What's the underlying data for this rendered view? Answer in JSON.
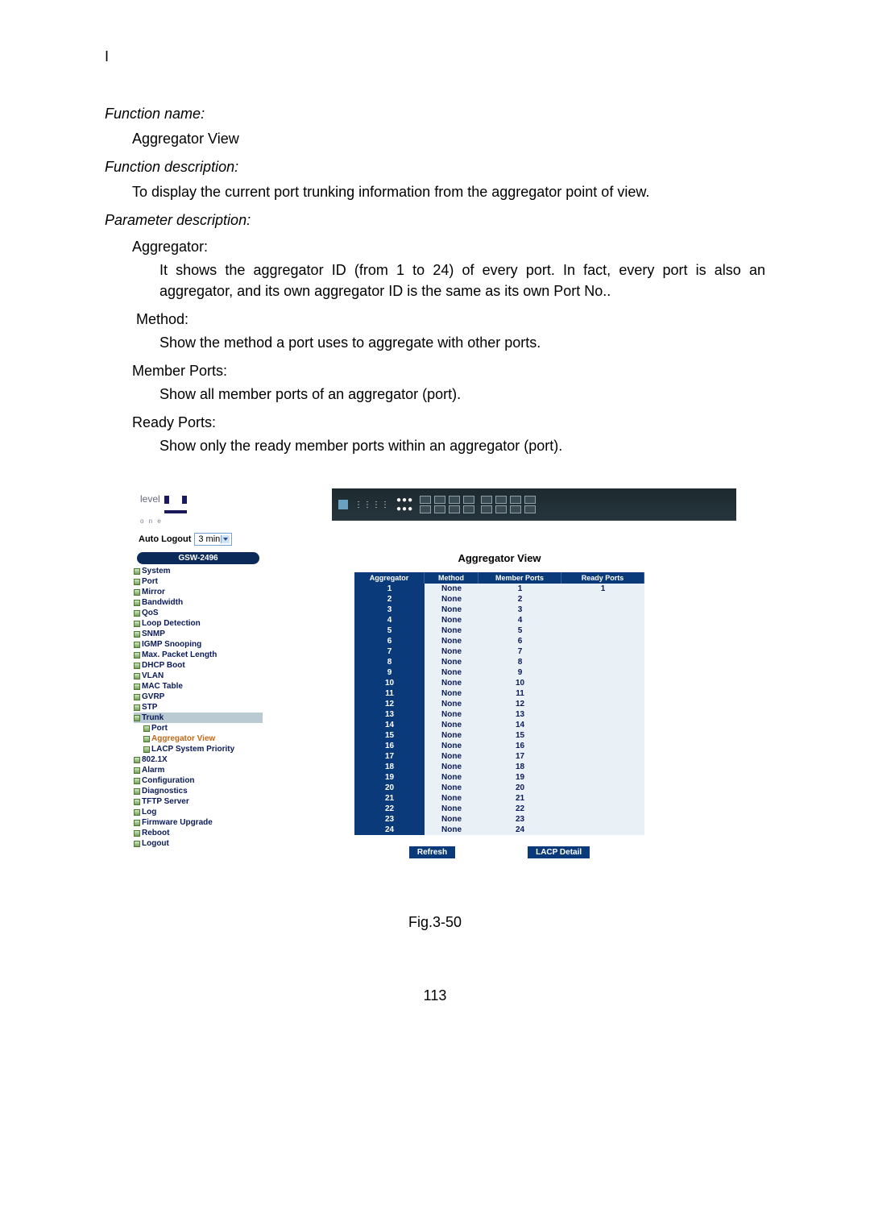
{
  "doc": {
    "top_marker": "I",
    "fn_name_label": "Function name:",
    "fn_name_value": "Aggregator View",
    "fn_desc_label": "Function description:",
    "fn_desc_value": "To display the current port trunking information from the aggregator point of view.",
    "param_label": "Parameter description:",
    "params": {
      "aggregator": {
        "label": "Aggregator:",
        "text": "It shows the aggregator ID (from 1 to 24) of every port. In fact, every port is also an aggregator, and its own aggregator ID is the same as its own Port No.."
      },
      "method": {
        "label": "Method:",
        "text": "Show the method a port uses to aggregate with other ports."
      },
      "member": {
        "label": "Member Ports:",
        "text": "Show all member ports of an aggregator (port)."
      },
      "ready": {
        "label": "Ready Ports:",
        "text": "Show only the ready member ports within an aggregator (port)."
      }
    },
    "caption": "Fig.3-50",
    "page_number": "113"
  },
  "ui": {
    "logo_text": "level",
    "logo_sub": "o n e",
    "auto_logout_label": "Auto Logout",
    "auto_logout_value": "3 min",
    "device_title": "GSW-2496",
    "nav": [
      {
        "label": "System"
      },
      {
        "label": "Port"
      },
      {
        "label": "Mirror"
      },
      {
        "label": "Bandwidth"
      },
      {
        "label": "QoS"
      },
      {
        "label": "Loop Detection"
      },
      {
        "label": "SNMP"
      },
      {
        "label": "IGMP Snooping"
      },
      {
        "label": "Max. Packet Length"
      },
      {
        "label": "DHCP Boot"
      },
      {
        "label": "VLAN"
      },
      {
        "label": "MAC Table"
      },
      {
        "label": "GVRP"
      },
      {
        "label": "STP"
      },
      {
        "label": "Trunk",
        "hilite": true
      },
      {
        "label": "Port",
        "sub": true
      },
      {
        "label": "Aggregator View",
        "sub": true,
        "sel": true
      },
      {
        "label": "LACP System Priority",
        "sub": true
      },
      {
        "label": "802.1X"
      },
      {
        "label": "Alarm"
      },
      {
        "label": "Configuration"
      },
      {
        "label": "Diagnostics"
      },
      {
        "label": "TFTP Server"
      },
      {
        "label": "Log"
      },
      {
        "label": "Firmware Upgrade"
      },
      {
        "label": "Reboot"
      },
      {
        "label": "Logout"
      }
    ],
    "pane_title": "Aggregator View",
    "table": {
      "headers": [
        "Aggregator",
        "Method",
        "Member Ports",
        "Ready Ports"
      ],
      "rows": [
        {
          "aggregator": "1",
          "method": "None",
          "member": "1",
          "ready": "1"
        },
        {
          "aggregator": "2",
          "method": "None",
          "member": "2",
          "ready": ""
        },
        {
          "aggregator": "3",
          "method": "None",
          "member": "3",
          "ready": ""
        },
        {
          "aggregator": "4",
          "method": "None",
          "member": "4",
          "ready": ""
        },
        {
          "aggregator": "5",
          "method": "None",
          "member": "5",
          "ready": ""
        },
        {
          "aggregator": "6",
          "method": "None",
          "member": "6",
          "ready": ""
        },
        {
          "aggregator": "7",
          "method": "None",
          "member": "7",
          "ready": ""
        },
        {
          "aggregator": "8",
          "method": "None",
          "member": "8",
          "ready": ""
        },
        {
          "aggregator": "9",
          "method": "None",
          "member": "9",
          "ready": ""
        },
        {
          "aggregator": "10",
          "method": "None",
          "member": "10",
          "ready": ""
        },
        {
          "aggregator": "11",
          "method": "None",
          "member": "11",
          "ready": ""
        },
        {
          "aggregator": "12",
          "method": "None",
          "member": "12",
          "ready": ""
        },
        {
          "aggregator": "13",
          "method": "None",
          "member": "13",
          "ready": ""
        },
        {
          "aggregator": "14",
          "method": "None",
          "member": "14",
          "ready": ""
        },
        {
          "aggregator": "15",
          "method": "None",
          "member": "15",
          "ready": ""
        },
        {
          "aggregator": "16",
          "method": "None",
          "member": "16",
          "ready": ""
        },
        {
          "aggregator": "17",
          "method": "None",
          "member": "17",
          "ready": ""
        },
        {
          "aggregator": "18",
          "method": "None",
          "member": "18",
          "ready": ""
        },
        {
          "aggregator": "19",
          "method": "None",
          "member": "19",
          "ready": ""
        },
        {
          "aggregator": "20",
          "method": "None",
          "member": "20",
          "ready": ""
        },
        {
          "aggregator": "21",
          "method": "None",
          "member": "21",
          "ready": ""
        },
        {
          "aggregator": "22",
          "method": "None",
          "member": "22",
          "ready": ""
        },
        {
          "aggregator": "23",
          "method": "None",
          "member": "23",
          "ready": ""
        },
        {
          "aggregator": "24",
          "method": "None",
          "member": "24",
          "ready": ""
        }
      ]
    },
    "refresh_label": "Refresh",
    "lacp_detail_label": "LACP Detail"
  }
}
